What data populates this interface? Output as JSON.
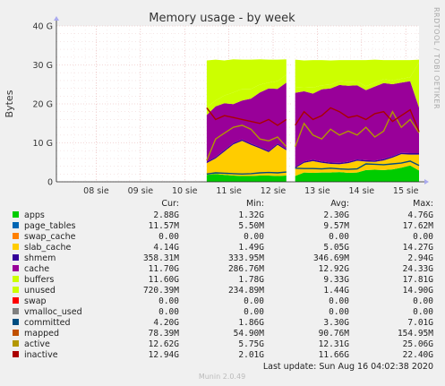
{
  "chart_data": {
    "type": "area",
    "title": "Memory usage - by week",
    "ylabel": "Bytes",
    "side_label": "RRDTOOL / TOBI OETIKER",
    "ylim": [
      0,
      40
    ],
    "yticks": [
      "0",
      "10 G",
      "20 G",
      "30 G",
      "40 G"
    ],
    "ytick_values": [
      0,
      10,
      20,
      30,
      40
    ],
    "xlim_days": [
      7.6,
      15.8
    ],
    "xticks": [
      "08 sie",
      "09 sie",
      "10 sie",
      "11 sie",
      "12 sie",
      "13 sie",
      "14 sie",
      "15 sie"
    ],
    "xtick_positions": [
      8.5,
      9.5,
      10.5,
      11.5,
      12.5,
      13.5,
      14.5,
      15.5
    ],
    "grid": true,
    "data_start_day": 11.0,
    "gap_day": 12.95,
    "series": [
      {
        "name": "apps",
        "color": "#00cc00",
        "cur": "2.88G",
        "min": "1.32G",
        "avg": "2.30G",
        "max": "4.76G"
      },
      {
        "name": "page_tables",
        "color": "#0066b3",
        "cur": "11.57M",
        "min": "5.50M",
        "avg": "9.57M",
        "max": "17.62M"
      },
      {
        "name": "swap_cache",
        "color": "#ff8000",
        "cur": "0.00",
        "min": "0.00",
        "avg": "0.00",
        "max": "0.00"
      },
      {
        "name": "slab_cache",
        "color": "#ffcc00",
        "cur": "4.14G",
        "min": "1.49G",
        "avg": "5.05G",
        "max": "14.27G"
      },
      {
        "name": "shmem",
        "color": "#330099",
        "cur": "358.31M",
        "min": "333.95M",
        "avg": "346.69M",
        "max": "2.94G"
      },
      {
        "name": "cache",
        "color": "#990099",
        "cur": "11.70G",
        "min": "286.76M",
        "avg": "12.92G",
        "max": "24.33G"
      },
      {
        "name": "buffers",
        "color": "#ccff00",
        "cur": "11.60G",
        "min": "1.78G",
        "avg": "9.33G",
        "max": "17.81G"
      },
      {
        "name": "unused",
        "color": "#ccff00",
        "cur": "720.39M",
        "min": "234.89M",
        "avg": "1.44G",
        "max": "14.90G"
      },
      {
        "name": "swap",
        "color": "#ff0000",
        "cur": "0.00",
        "min": "0.00",
        "avg": "0.00",
        "max": "0.00"
      },
      {
        "name": "vmalloc_used",
        "color": "#808080",
        "cur": "0.00",
        "min": "0.00",
        "avg": "0.00",
        "max": "0.00"
      },
      {
        "name": "committed",
        "color": "#004d80",
        "cur": "4.20G",
        "min": "1.86G",
        "avg": "3.30G",
        "max": "7.01G"
      },
      {
        "name": "mapped",
        "color": "#c05000",
        "cur": "78.39M",
        "min": "54.90M",
        "avg": "90.76M",
        "max": "154.95M"
      },
      {
        "name": "active",
        "color": "#b39700",
        "cur": "12.62G",
        "min": "5.75G",
        "avg": "12.31G",
        "max": "25.06G"
      },
      {
        "name": "inactive",
        "color": "#aa0000",
        "cur": "12.94G",
        "min": "2.01G",
        "avg": "11.66G",
        "max": "22.40G"
      }
    ],
    "stack_profile": {
      "days": [
        11.0,
        11.2,
        11.4,
        11.6,
        11.8,
        12.0,
        12.2,
        12.4,
        12.6,
        12.8,
        12.95,
        13.0,
        13.2,
        13.4,
        13.6,
        13.8,
        14.0,
        14.2,
        14.4,
        14.6,
        14.8,
        15.0,
        15.2,
        15.4,
        15.6,
        15.8
      ],
      "apps": [
        1.8,
        2.0,
        1.8,
        1.6,
        1.5,
        1.5,
        1.6,
        1.6,
        1.5,
        1.6,
        1.6,
        1.5,
        2.4,
        2.3,
        2.4,
        2.4,
        2.5,
        2.3,
        2.4,
        3.0,
        3.1,
        3.0,
        3.2,
        3.6,
        4.2,
        2.9
      ],
      "slab_cache": [
        3.0,
        4.0,
        6.0,
        8.0,
        9.0,
        8.0,
        7.0,
        6.0,
        8.0,
        6.5,
        0,
        2.0,
        2.5,
        3.0,
        2.5,
        2.2,
        2.0,
        2.5,
        3.0,
        2.2,
        2.0,
        2.5,
        3.0,
        3.5,
        2.8,
        4.1
      ],
      "shmem": [
        0.35,
        0.35,
        0.35,
        0.35,
        0.35,
        0.35,
        0.35,
        0.35,
        0.35,
        0.35,
        0,
        0.35,
        0.35,
        0.35,
        0.35,
        0.35,
        0.35,
        0.35,
        0.35,
        0.35,
        0.35,
        0.35,
        0.35,
        0.35,
        0.35,
        0.36
      ],
      "cache": [
        12.0,
        13.0,
        12.0,
        10.0,
        10.0,
        11.5,
        14.0,
        16.0,
        14.0,
        17.0,
        0,
        19.0,
        18.0,
        17.0,
        18.5,
        19.0,
        20.0,
        19.5,
        19.0,
        18.0,
        19.0,
        19.5,
        18.5,
        18.0,
        18.5,
        11.7
      ],
      "buffers": [
        2.0,
        1.5,
        2.0,
        3.0,
        3.0,
        2.5,
        2.0,
        1.5,
        2.0,
        2.0,
        0,
        1.5,
        1.0,
        1.5,
        1.0,
        1.0,
        1.0,
        1.0,
        1.0,
        1.0,
        1.0,
        1.0,
        1.0,
        1.0,
        1.0,
        11.6
      ],
      "unused": [
        12.0,
        10.5,
        9.0,
        8.5,
        7.5,
        7.5,
        6.5,
        5.9,
        5.5,
        4.0,
        0,
        7.0,
        6.9,
        7.1,
        6.5,
        6.2,
        5.4,
        5.6,
        5.5,
        6.7,
        5.9,
        4.9,
        5.2,
        4.8,
        4.4,
        0.7
      ],
      "committed": [
        2.0,
        2.3,
        2.2,
        2.1,
        2.0,
        2.1,
        2.3,
        2.4,
        2.3,
        2.5,
        2.4,
        3.5,
        3.4,
        3.4,
        3.3,
        3.5,
        3.3,
        3.2,
        3.3,
        4.6,
        4.5,
        4.4,
        4.6,
        4.8,
        5.3,
        4.2
      ],
      "active": [
        5.5,
        11.0,
        12.5,
        14.0,
        14.5,
        13.5,
        11.0,
        10.5,
        11.5,
        9.0,
        8.0,
        9.0,
        15.0,
        12.0,
        11.0,
        13.5,
        12.0,
        13.0,
        12.0,
        14.0,
        11.5,
        13.0,
        18.0,
        14.0,
        16.0,
        12.6
      ],
      "inactive": [
        19.0,
        16.0,
        17.0,
        16.5,
        16.0,
        15.5,
        15.0,
        16.0,
        14.5,
        16.0,
        15.0,
        14.5,
        18.0,
        16.0,
        17.0,
        19.0,
        18.0,
        16.5,
        17.0,
        16.0,
        17.5,
        18.0,
        15.5,
        17.0,
        18.5,
        12.9
      ]
    }
  },
  "table": {
    "headers": [
      "Cur:",
      "Min:",
      "Avg:",
      "Max:"
    ]
  },
  "footer": {
    "last_update": "Last update: Sun Aug 16 04:02:38 2020",
    "munin_version": "Munin 2.0.49"
  }
}
